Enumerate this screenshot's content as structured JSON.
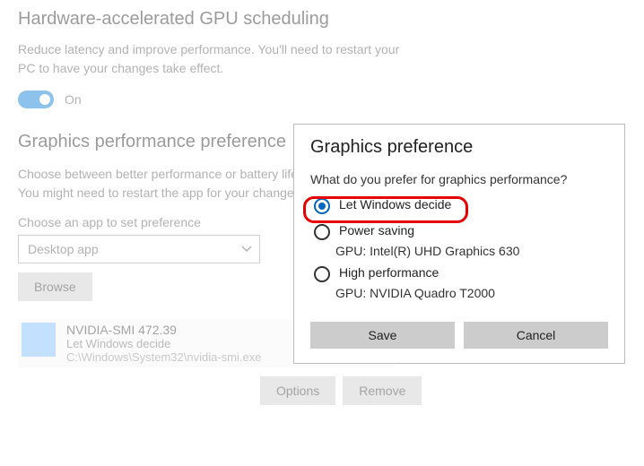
{
  "gpu": {
    "heading": "Hardware-accelerated GPU scheduling",
    "body_line1": "Reduce latency and improve performance. You'll need to restart your",
    "body_line2": "PC to have your changes take effect.",
    "toggle_state": "On"
  },
  "perf": {
    "heading": "Graphics performance preference",
    "body_line1": "Choose between better performance or battery life",
    "body_line2": "You might need to restart the app for your changes",
    "choose_label": "Choose an app to set preference",
    "select_value": "Desktop app",
    "browse_label": "Browse"
  },
  "app": {
    "name": "NVIDIA-SMI 472.39",
    "pref": "Let Windows decide",
    "path": "C:\\Windows\\System32\\nvidia-smi.exe",
    "options_label": "Options",
    "remove_label": "Remove"
  },
  "dialog": {
    "title": "Graphics preference",
    "question": "What do you prefer for graphics performance?",
    "opt1_label": "Let Windows decide",
    "opt2_label": "Power saving",
    "opt2_sub": "GPU: Intel(R) UHD Graphics 630",
    "opt3_label": "High performance",
    "opt3_sub": "GPU: NVIDIA Quadro T2000",
    "save_label": "Save",
    "cancel_label": "Cancel"
  }
}
